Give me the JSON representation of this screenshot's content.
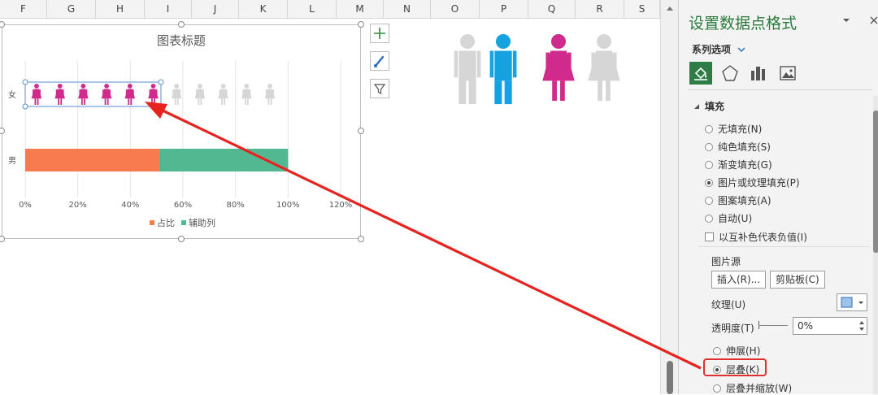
{
  "columns": [
    "F",
    "G",
    "H",
    "I",
    "J",
    "K",
    "L",
    "M",
    "N",
    "O",
    "P",
    "Q",
    "R",
    "S"
  ],
  "chart": {
    "title": "图表标题",
    "categories": [
      "女",
      "男"
    ],
    "x_ticks": [
      "0%",
      "20%",
      "40%",
      "60%",
      "80%",
      "100%",
      "120%"
    ],
    "legend": [
      {
        "name": "占比",
        "color": "#f87a4f"
      },
      {
        "name": "辅助列",
        "color": "#52b892"
      }
    ],
    "female_icons_filled": 6,
    "female_icons_total": 11,
    "colors": {
      "female": "#d02b8c",
      "female_faded": "#d6d6d6",
      "male": "#14a3e0",
      "male_faded": "#d6d6d6"
    }
  },
  "chart_data": {
    "type": "bar",
    "categories": [
      "女",
      "男"
    ],
    "series": [
      {
        "name": "占比",
        "values": [
          0.51,
          0.51
        ]
      },
      {
        "name": "辅助列",
        "values": [
          1.0,
          1.0
        ]
      }
    ],
    "title": "图表标题",
    "xlim": [
      0,
      1.2
    ],
    "x_ticks": [
      "0%",
      "20%",
      "40%",
      "60%",
      "80%",
      "100%",
      "120%"
    ],
    "grid": true,
    "legend": "bottom"
  },
  "panel": {
    "title": "设置数据点格式",
    "subtitle": "系列选项",
    "section": "填充",
    "fill_options": [
      "无填充(N)",
      "纯色填充(S)",
      "渐变填充(G)",
      "图片或纹理填充(P)",
      "图案填充(A)",
      "自动(U)"
    ],
    "selected_fill": 3,
    "invert_label": "以互补色代表负值(I)",
    "picture_source": "图片源",
    "insert_label": "插入(R)...",
    "clipboard_label": "剪贴板(C)",
    "texture_label": "纹理(U)",
    "transparency_label": "透明度(T)",
    "transparency_value": "0%",
    "stretch_label": "伸展(H)",
    "stack_label": "层叠(K)",
    "stack_scale_label": "层叠并缩放(W)"
  }
}
